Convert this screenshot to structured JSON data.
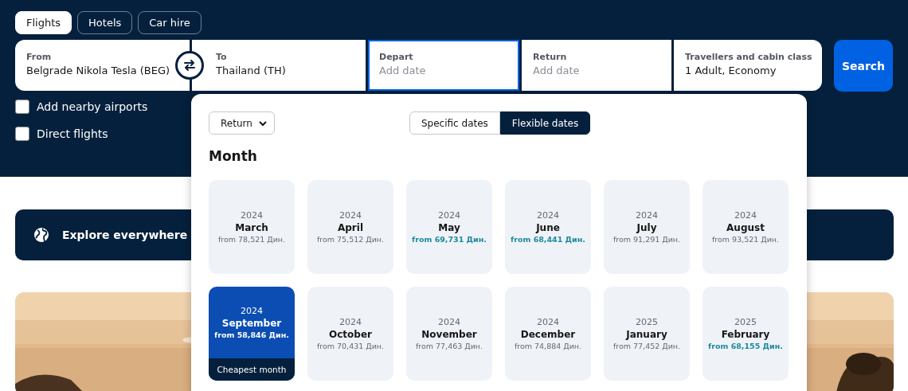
{
  "tabs": [
    {
      "label": "Flights",
      "selected": true
    },
    {
      "label": "Hotels",
      "selected": false
    },
    {
      "label": "Car hire",
      "selected": false
    }
  ],
  "search": {
    "from": {
      "label": "From",
      "value": "Belgrade Nikola Tesla (BEG)"
    },
    "to": {
      "label": "To",
      "value": "Thailand (TH)"
    },
    "depart": {
      "label": "Depart",
      "placeholder": "Add date",
      "focused": true
    },
    "return": {
      "label": "Return",
      "placeholder": "Add date",
      "focused": false
    },
    "travellers": {
      "label": "Travellers and cabin class",
      "value": "1 Adult, Economy"
    },
    "button": "Search"
  },
  "options": [
    {
      "label": "Add nearby airports",
      "checked": false
    },
    {
      "label": "Direct flights",
      "checked": false
    }
  ],
  "explore": {
    "label": "Explore everywhere"
  },
  "date_picker": {
    "trip_type": "Return",
    "modes": [
      {
        "label": "Specific dates",
        "selected": false
      },
      {
        "label": "Flexible dates",
        "selected": true
      }
    ],
    "heading": "Month",
    "months": [
      {
        "year": "2024",
        "month": "March",
        "price": "from 78,521 Дин.",
        "cheap": false,
        "selected": false
      },
      {
        "year": "2024",
        "month": "April",
        "price": "from 75,512 Дин.",
        "cheap": false,
        "selected": false
      },
      {
        "year": "2024",
        "month": "May",
        "price": "from 69,731 Дин.",
        "cheap": true,
        "selected": false
      },
      {
        "year": "2024",
        "month": "June",
        "price": "from 68,441 Дин.",
        "cheap": true,
        "selected": false
      },
      {
        "year": "2024",
        "month": "July",
        "price": "from 91,291 Дин.",
        "cheap": false,
        "selected": false
      },
      {
        "year": "2024",
        "month": "August",
        "price": "from 93,521 Дин.",
        "cheap": false,
        "selected": false
      },
      {
        "year": "2024",
        "month": "September",
        "price": "from 58,846 Дин.",
        "cheap": true,
        "selected": true,
        "badge": "Cheapest month"
      },
      {
        "year": "2024",
        "month": "October",
        "price": "from 70,431 Дин.",
        "cheap": false,
        "selected": false
      },
      {
        "year": "2024",
        "month": "November",
        "price": "from 77,463 Дин.",
        "cheap": false,
        "selected": false
      },
      {
        "year": "2024",
        "month": "December",
        "price": "from 74,884 Дин.",
        "cheap": false,
        "selected": false
      },
      {
        "year": "2025",
        "month": "January",
        "price": "from 77,452 Дин.",
        "cheap": false,
        "selected": false
      },
      {
        "year": "2025",
        "month": "February",
        "price": "from 68,155 Дин.",
        "cheap": true,
        "selected": false
      }
    ]
  }
}
